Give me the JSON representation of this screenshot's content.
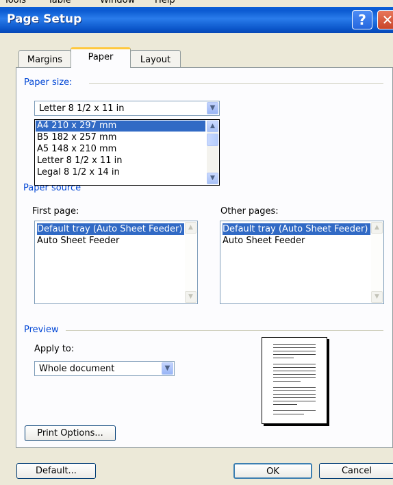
{
  "menubar": {
    "items": [
      "Tools",
      "Table",
      "Window",
      "Help"
    ]
  },
  "window": {
    "title": "Page Setup"
  },
  "tabs": [
    {
      "label": "Margins",
      "active": false
    },
    {
      "label": "Paper",
      "active": true
    },
    {
      "label": "Layout",
      "active": false
    }
  ],
  "paper_size": {
    "group_label": "Paper size:",
    "selected_value": "Letter 8 1/2 x 11 in",
    "options": [
      "A4 210 x 297 mm",
      "B5 182 x 257 mm",
      "A5 148 x 210 mm",
      "Letter 8 1/2 x 11 in",
      "Legal 8 1/2 x 14 in"
    ],
    "highlighted_option": "A4 210 x 297 mm"
  },
  "paper_source": {
    "group_label": "Paper source",
    "first_page": {
      "label": "First page:",
      "items": [
        "Default tray (Auto Sheet Feeder)",
        "Auto Sheet Feeder"
      ],
      "selected": "Default tray (Auto Sheet Feeder)"
    },
    "other_pages": {
      "label": "Other pages:",
      "items": [
        "Default tray (Auto Sheet Feeder)",
        "Auto Sheet Feeder"
      ],
      "selected": "Default tray (Auto Sheet Feeder)"
    }
  },
  "preview": {
    "group_label": "Preview",
    "apply_to_label": "Apply to:",
    "apply_to_value": "Whole document"
  },
  "buttons": {
    "print_options": "Print Options...",
    "default": "Default...",
    "ok": "OK",
    "cancel": "Cancel"
  },
  "colors": {
    "titlebar": "#0A5FD8",
    "dialog_bg": "#ECE9D8",
    "group_label": "#0046D5",
    "selection": "#316AC5",
    "active_tab_accent": "#FFC83C"
  }
}
